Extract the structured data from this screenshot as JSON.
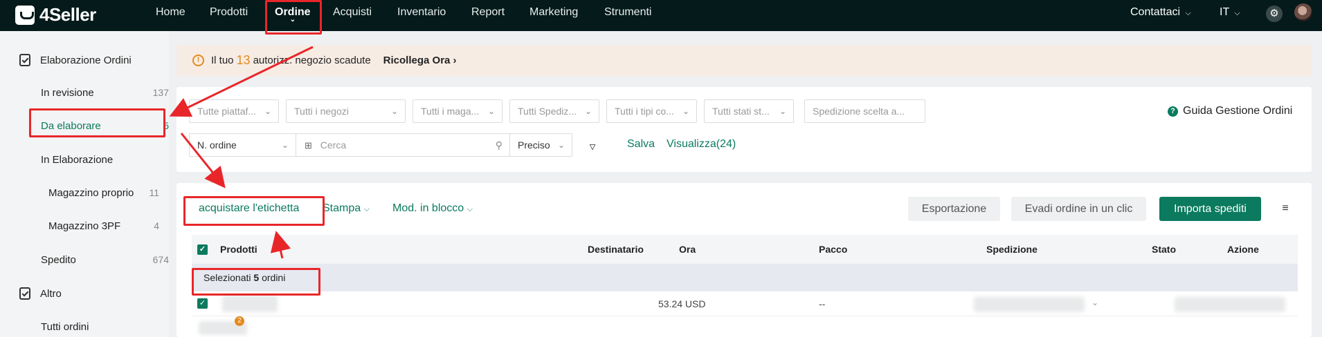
{
  "brand": {
    "name": "4Seller"
  },
  "nav": {
    "items": [
      "Home",
      "Prodotti",
      "Ordine",
      "Acquisti",
      "Inventario",
      "Report",
      "Marketing",
      "Strumenti"
    ],
    "active": "Ordine",
    "contact": "Contattaci",
    "language": "IT"
  },
  "sidebar": {
    "group1": "Elaborazione Ordini",
    "in_revisione": {
      "label": "In revisione",
      "count": "137"
    },
    "da_elaborare": {
      "label": "Da elaborare",
      "count": "5"
    },
    "in_elaborazione": {
      "label": "In Elaborazione"
    },
    "magazzino_proprio": {
      "label": "Magazzino proprio",
      "count": "11"
    },
    "magazzino_3pf": {
      "label": "Magazzino 3PF",
      "count": "4"
    },
    "spedito": {
      "label": "Spedito",
      "count": "674"
    },
    "group2": "Altro",
    "tutti_ordini": {
      "label": "Tutti ordini"
    }
  },
  "alert": {
    "prefix": "Il tuo",
    "count": "13",
    "suffix": "autorizz. negozio scadute",
    "link": "Ricollega Ora"
  },
  "filters": {
    "platform": "Tutte piattaf...",
    "shops": "Tutti i negozi",
    "warehouse": "Tutti i maga...",
    "shipping": "Tutti Spediz...",
    "types": "Tutti i tipi co...",
    "states": "Tutti stati st...",
    "chosen_shipping": "Spedizione scelta a...",
    "guide": "Guida Gestione Ordini",
    "search_field": "N. ordine",
    "search_placeholder": "Cerca",
    "match_mode": "Preciso",
    "save": "Salva",
    "views": "Visualizza(24)"
  },
  "actions": {
    "buy_label": "acquistare l'etichetta",
    "print": "Stampa",
    "bulk_edit": "Mod. in blocco",
    "export": "Esportazione",
    "one_click": "Evadi ordine in un clic",
    "import_shipped": "Importa spediti"
  },
  "table": {
    "columns": [
      "Prodotti",
      "Destinatario",
      "Ora",
      "Pacco",
      "Spedizione",
      "Stato",
      "Azione"
    ],
    "selected_prefix": "Selezionati",
    "selected_count": "5",
    "selected_suffix": "ordini",
    "row1": {
      "amount": "53.24 USD",
      "package": "--",
      "badge": "2"
    }
  },
  "colors": {
    "accent": "#0b7a5e",
    "topbar": "#051a1a",
    "warning": "#e68a1c",
    "annotation": "#e8262a"
  }
}
